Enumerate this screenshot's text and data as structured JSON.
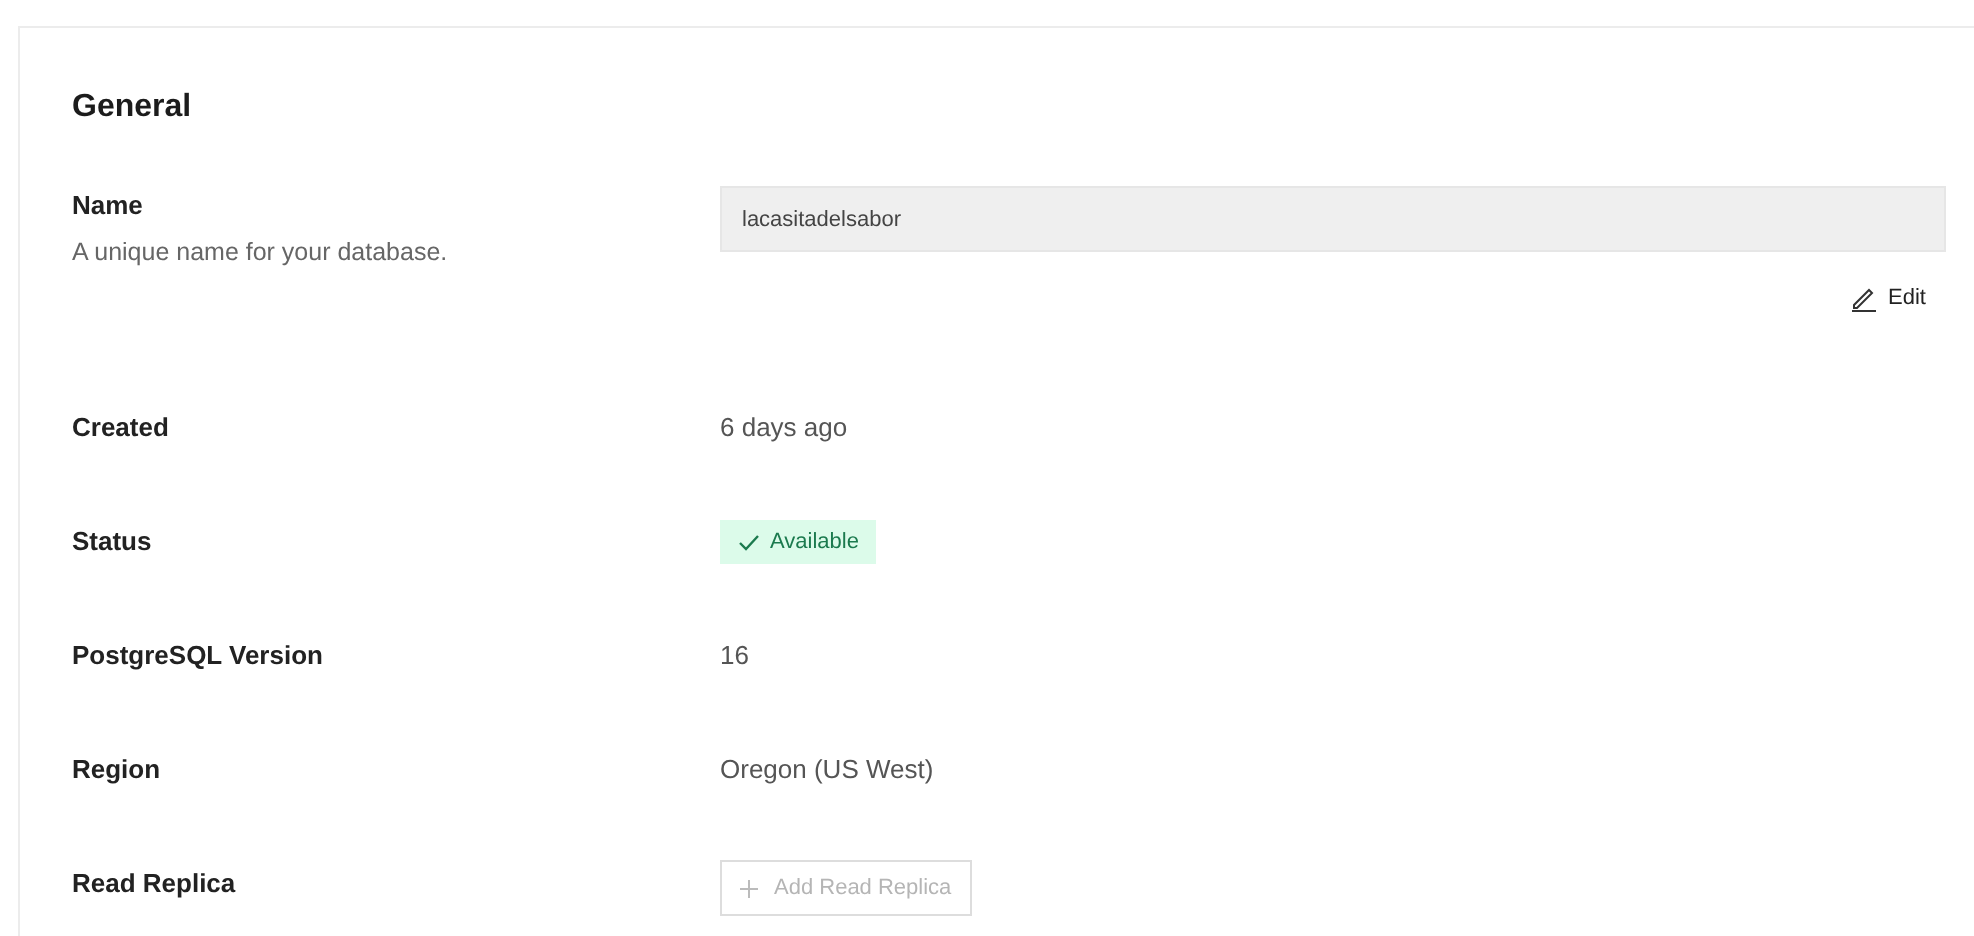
{
  "section": {
    "title": "General"
  },
  "rows": [
    {
      "kind": "field",
      "label": "Name",
      "description": "A unique name for your database.",
      "value": "lacasitadelsabor",
      "action": "Edit"
    },
    {
      "kind": "text",
      "label": "Created",
      "value": "6 days ago"
    },
    {
      "kind": "status",
      "label": "Status",
      "value": "Available"
    },
    {
      "kind": "text",
      "label": "PostgreSQL Version",
      "value": "16"
    },
    {
      "kind": "text",
      "label": "Region",
      "value": "Oregon (US West)"
    },
    {
      "kind": "button",
      "label": "Read Replica",
      "value": "Add Read Replica",
      "disabled": true
    }
  ]
}
